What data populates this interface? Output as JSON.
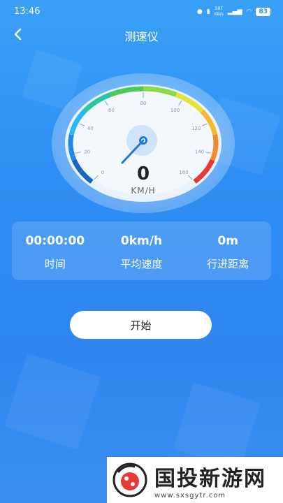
{
  "status_bar": {
    "time": "13:46",
    "net_speed": "597",
    "net_unit": "KB/s",
    "battery": "83"
  },
  "header": {
    "title": "测速仪",
    "back_icon": "chevron-left-icon"
  },
  "gauge": {
    "speed": "0",
    "unit": "KM/H",
    "ticks": [
      "0",
      "20",
      "40",
      "60",
      "80",
      "100",
      "120",
      "140",
      "160"
    ]
  },
  "stats": [
    {
      "value": "00:00:00",
      "label": "时间"
    },
    {
      "value": "0km/h",
      "label": "平均速度"
    },
    {
      "value": "0m",
      "label": "行进距离"
    }
  ],
  "start_button": {
    "label": "开始"
  },
  "watermark": {
    "name": "国投新游网",
    "url": "www.sxsgytr.com"
  }
}
